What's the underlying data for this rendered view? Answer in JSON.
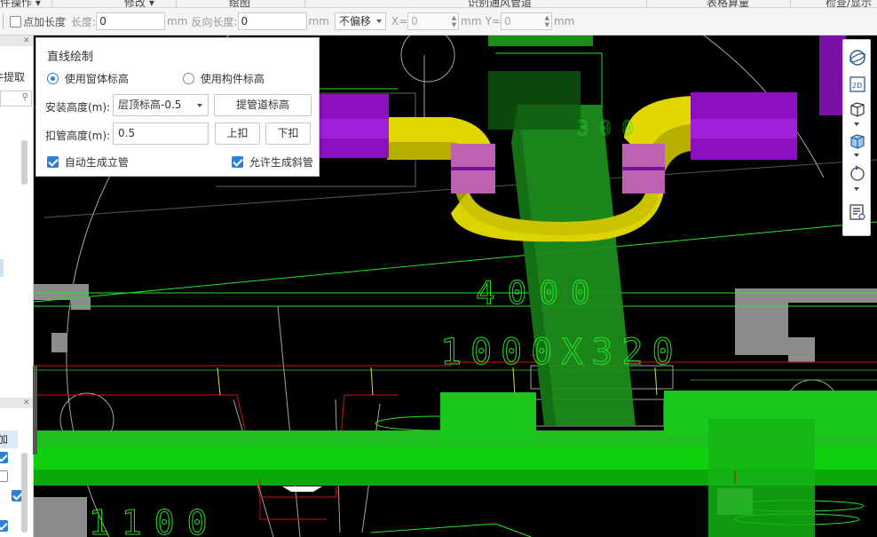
{
  "ribbon": {
    "groups": [
      {
        "label": "件操作 ▾"
      },
      {
        "label": "修改 ▾"
      },
      {
        "label": "绘图"
      },
      {
        "label": "识别通风管道"
      },
      {
        "label": "表格算量"
      },
      {
        "label": "检查/显示"
      }
    ]
  },
  "toolbar": {
    "point_length_label": "点加长度",
    "length_label": "长度:",
    "length_value": "0",
    "unit_mm": "mm",
    "reverse_length_label": "反向长度:",
    "reverse_length_value": "0",
    "offset_option": "不偏移",
    "x_label": "X=",
    "x_value": "0",
    "y_label": "Y=",
    "y_value": "0"
  },
  "left_panel": {
    "extract_label": "件提取",
    "add_label": "加"
  },
  "dialog": {
    "title": "直线绘制",
    "radio_window_elevation": "使用窗体标高",
    "radio_component_elevation": "使用构件标高",
    "install_height_label": "安装高度(m):",
    "install_height_value": "层顶标高-0.5",
    "extract_elevation_button": "提管道标高",
    "buckle_height_label": "扣管高度(m):",
    "buckle_height_value": "0.5",
    "buckle_up_button": "上扣",
    "buckle_down_button": "下扣",
    "auto_riser_label": "自动生成立管",
    "allow_slope_label": "允许生成斜管"
  },
  "cad": {
    "dimension_4000": "4000",
    "dimension_duct_size": "1000X320",
    "dimension_1100": "1100",
    "dimension_300": "300"
  },
  "right_toolbar": {
    "icons": [
      "globe-icon",
      "view-2d-icon",
      "wireframe-cube-icon",
      "solid-cube-icon",
      "rotate-icon",
      "layer-settings-icon"
    ]
  },
  "colors": {
    "canvas_bg": "#000000",
    "duct_green": "#0fcf0f",
    "duct_dark_green": "#1f8f1f",
    "duct_yellow": "#d8d000",
    "duct_purple": "#8a10c0",
    "duct_pink": "#c060b0",
    "wall_gray": "#8c8c8c",
    "line_green": "#22e622",
    "line_red": "#d01010",
    "accent_blue": "#2f7fd9"
  }
}
